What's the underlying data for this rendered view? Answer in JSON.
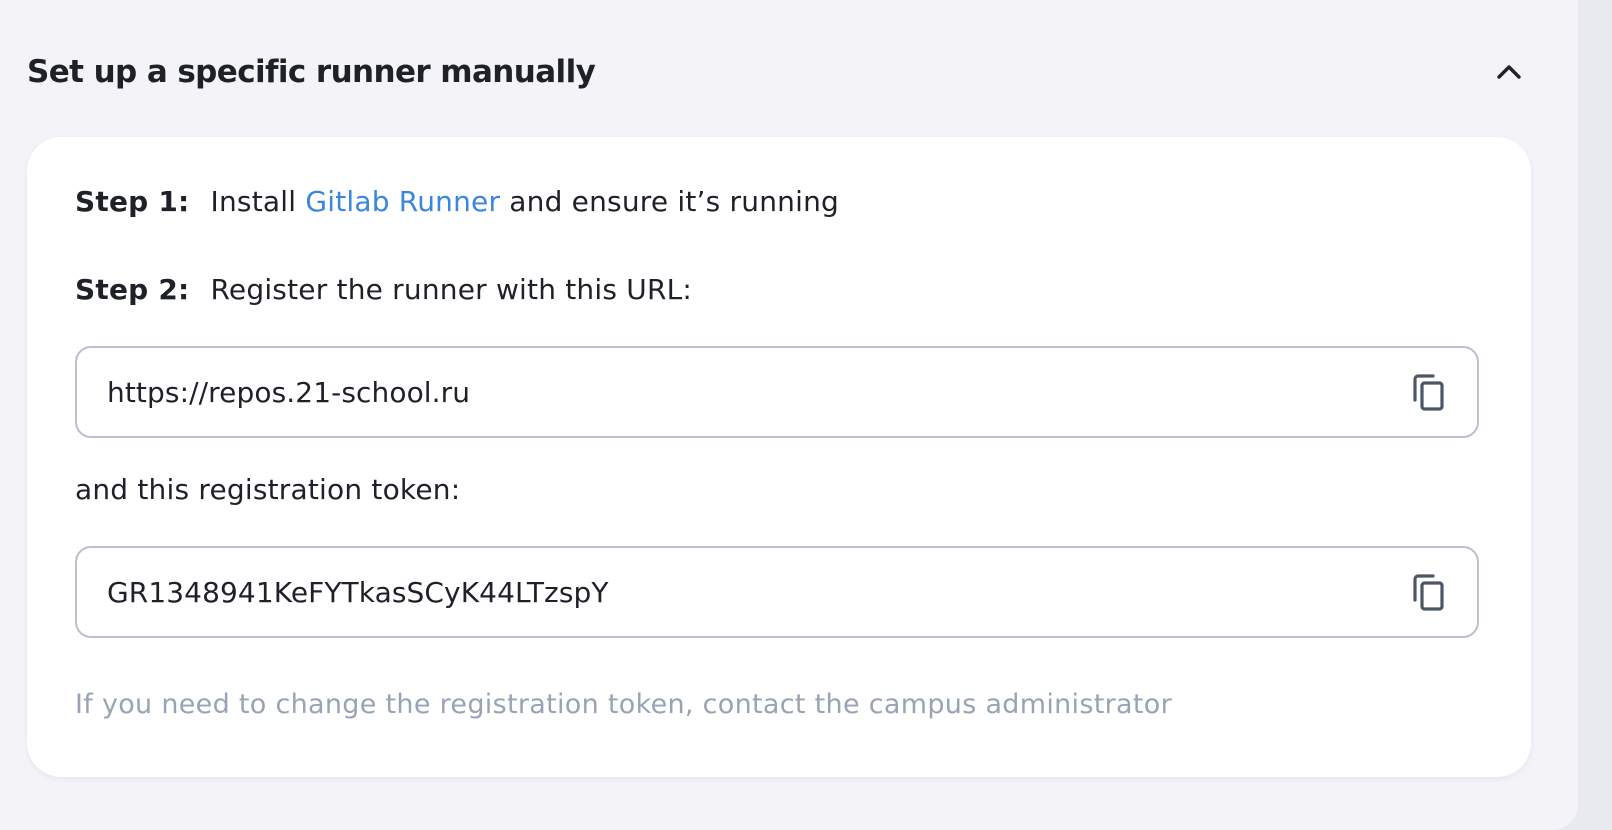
{
  "section": {
    "title": "Set up a specific runner manually",
    "toggle_icon": "chevron-up-icon"
  },
  "card": {
    "step1": {
      "label": "Step 1:",
      "text_before": "Install",
      "link_text": "Gitlab Runner",
      "text_after": "and ensure it’s running"
    },
    "step2": {
      "label": "Step 2:",
      "text": "Register the runner with this URL:"
    },
    "url_field": {
      "value": "https://repos.21-school.ru",
      "copy_icon": "copy-icon"
    },
    "token_label": "and this registration token:",
    "token_field": {
      "value": "GR1348941KeFYTkasSCyK44LTzspY",
      "copy_icon": "copy-icon"
    },
    "hint": "If you need to change the registration token, contact the campus administrator"
  },
  "colors": {
    "link": "#3a86e0",
    "text": "#1f2128",
    "hint": "#98a4b5",
    "field_border": "#b9c1cd",
    "panel_bg": "#f3f3f8",
    "card_bg": "#ffffff",
    "icon": "#4d5666"
  }
}
